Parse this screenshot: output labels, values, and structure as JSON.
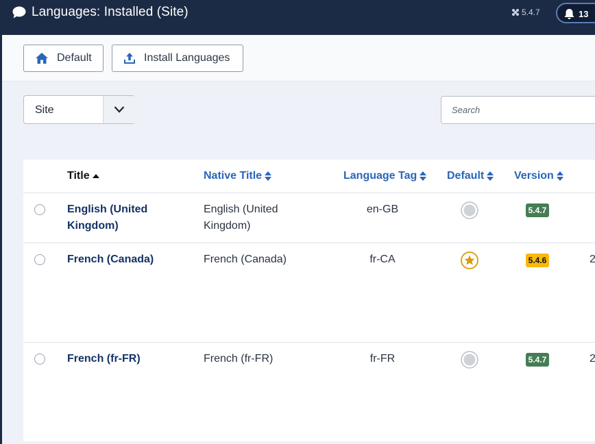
{
  "header": {
    "title": "Languages: Installed (Site)",
    "version": "5.4.7",
    "notifications_count": "13"
  },
  "toolbar": {
    "default_label": "Default",
    "install_label": "Install Languages"
  },
  "filter": {
    "client_value": "Site",
    "search_placeholder": "Search"
  },
  "table": {
    "columns": {
      "title": "Title",
      "native_title": "Native Title",
      "language_tag": "Language Tag",
      "default": "Default",
      "version": "Version"
    },
    "rows": [
      {
        "title": "English (United Kingdom)",
        "native_title": "English (United Kingdom)",
        "tag": "en-GB",
        "default": false,
        "version": "5.4.7",
        "version_status": "current",
        "extra": ""
      },
      {
        "title": "French (Canada)",
        "native_title": "French (Canada)",
        "tag": "fr-CA",
        "default": true,
        "version": "5.4.6",
        "version_status": "outdated",
        "extra": "2"
      },
      {
        "title": "French (fr-FR)",
        "native_title": "French (fr-FR)",
        "tag": "fr-FR",
        "default": false,
        "version": "5.4.7",
        "version_status": "current",
        "extra": "2"
      }
    ]
  },
  "colors": {
    "header_bg": "#1c2b45",
    "link_blue": "#2a66b8",
    "badge_green": "#457d54",
    "badge_yellow": "#f8b80e",
    "star_gold": "#d89a0a"
  },
  "icons": {
    "header": "comment-icon",
    "version": "joomla-icon",
    "notifications": "bell-icon",
    "default_button": "home-icon",
    "install_button": "upload-icon",
    "select": "chevron-down-icon",
    "sort": "sort-icon",
    "default_on": "star-icon",
    "default_off": "circle-icon"
  }
}
